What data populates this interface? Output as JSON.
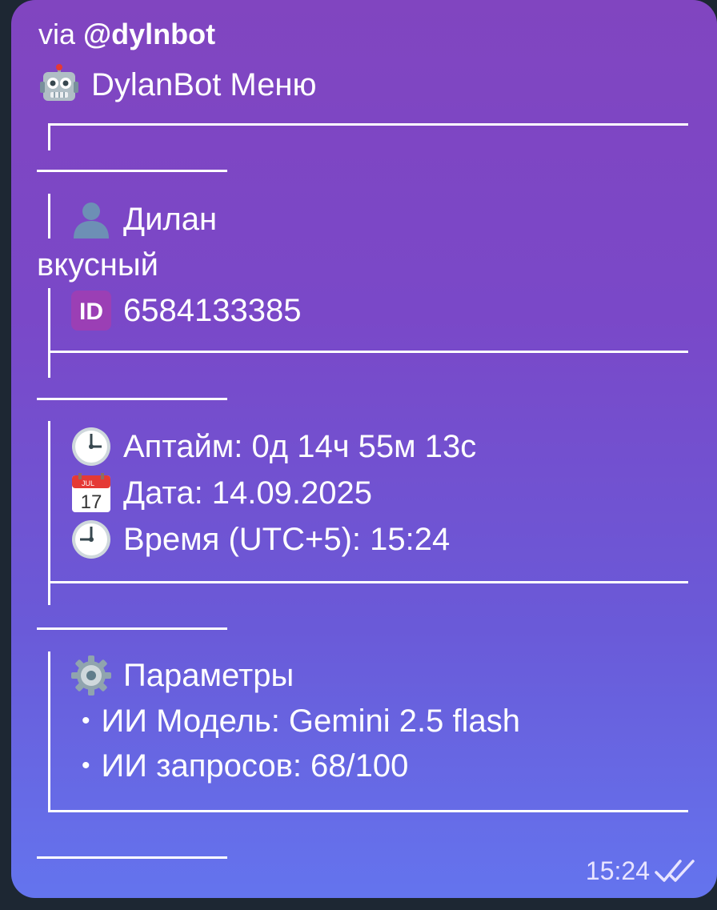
{
  "message": {
    "via_prefix": "via ",
    "bot_username": "@dylnbot",
    "title": "DylanBot Меню",
    "user": {
      "name": "Дилан",
      "name_wrap": "вкусный",
      "id": "6584133385"
    },
    "status": {
      "uptime": "Аптайм: 0д 14ч 55м 13с",
      "date": "Дата: 14.09.2025",
      "time": "Время (UTC+5): 15:24"
    },
    "params": {
      "title": "Параметры",
      "model": "ИИ Модель: Gemini 2.5 flash",
      "requests": "ИИ запросов: 68/100"
    },
    "bullet": "•",
    "sent_time": "15:24"
  },
  "icons": {
    "title": "robot-icon",
    "user": "user-silhouette-icon",
    "id": "id-badge-icon",
    "uptime": "clock-icon",
    "date": "calendar-icon",
    "time": "clock-nine-icon",
    "params": "gear-icon",
    "status": "double-check-icon"
  },
  "colors": {
    "bubble_top": "#8145c0",
    "bubble_bottom": "#6474ee",
    "text": "#ffffff",
    "id_badge": "#9b3fb5"
  }
}
